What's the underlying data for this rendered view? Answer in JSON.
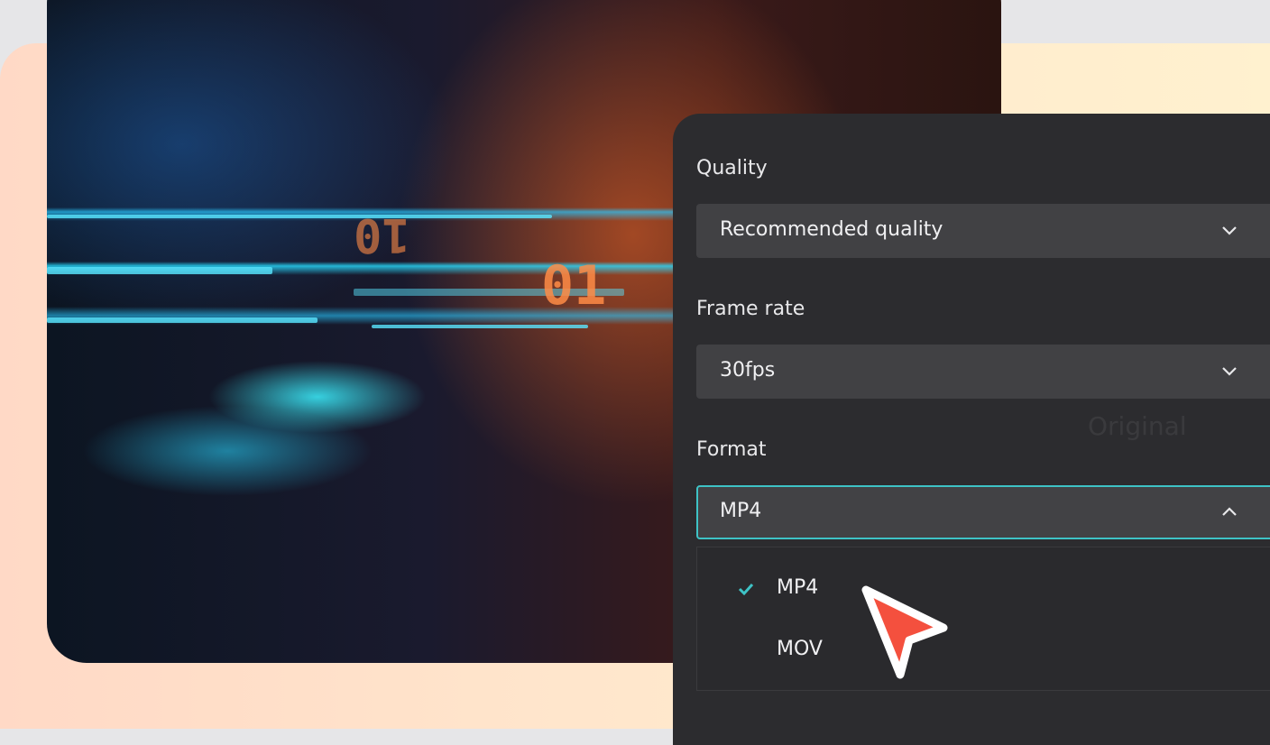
{
  "hero": {
    "digits": [
      "01",
      "10"
    ]
  },
  "export": {
    "quality": {
      "label": "Quality",
      "value": "Recommended quality"
    },
    "frame_rate": {
      "label": "Frame rate",
      "value": "30fps"
    },
    "format": {
      "label": "Format",
      "value": "MP4",
      "options": [
        {
          "label": "MP4",
          "selected": true
        },
        {
          "label": "MOV",
          "selected": false
        }
      ]
    },
    "background_ghost_text": "Original"
  },
  "colors": {
    "accent": "#3ec3c6",
    "cursor": "#f4503e",
    "panel": "#2c2c2f"
  }
}
